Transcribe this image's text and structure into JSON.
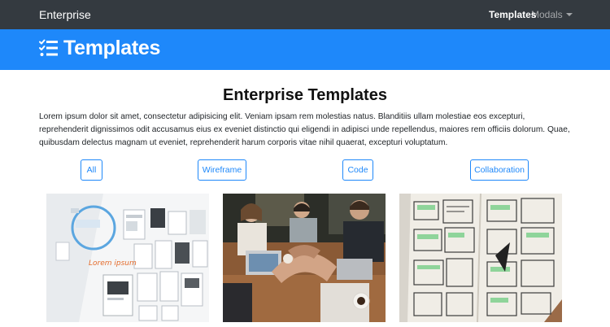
{
  "navbar": {
    "brand": "Enterprise",
    "items": [
      {
        "label": "Templates",
        "active": true
      },
      {
        "label": "Modals",
        "dropdown": true
      }
    ]
  },
  "header": {
    "icon": "checklist-icon",
    "title": "Templates"
  },
  "main": {
    "title": "Enterprise Templates",
    "intro": "Lorem ipsum dolor sit amet, consectetur adipisicing elit. Veniam ipsam rem molestias natus. Blanditiis ullam molestiae eos excepturi, reprehenderit dignissimos odit accusamus eius ex eveniet distinctio qui eligendi in adipisci unde repellendus, maiores rem officiis dolorum. Quae, quibusdam delectus magnam ut eveniet, reprehenderit harum corporis vitae nihil quaerat, excepturi voluptatum.",
    "filters": [
      "All",
      "Wireframe",
      "Code",
      "Collaboration"
    ],
    "cards": [
      {
        "image": "wireframe-sketches-on-wall"
      },
      {
        "image": "team-hands-stacked-at-table"
      },
      {
        "image": "hand-drawn-wireframe-notebook"
      }
    ]
  },
  "colors": {
    "navbar_bg": "#343a40",
    "header_bg": "#1e88fa",
    "accent": "#1e88fa"
  }
}
